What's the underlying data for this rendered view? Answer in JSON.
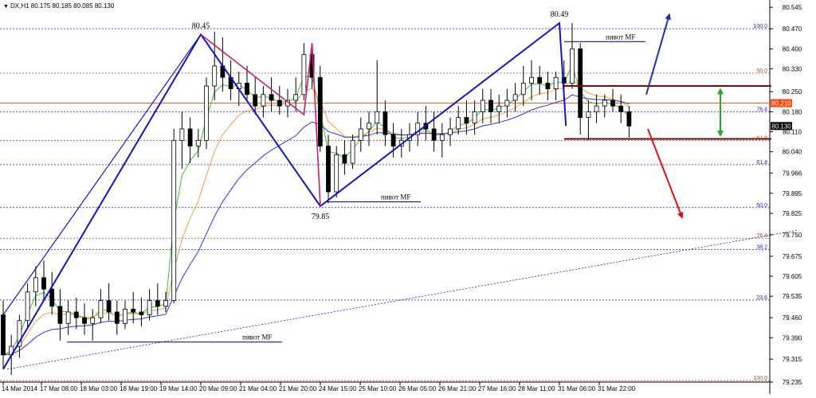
{
  "window": {
    "symbol_line": "DX,H1  80.175 80.185 80.085 80.130",
    "menu_glyph": "▼"
  },
  "colors": {
    "background": "#ffffff",
    "grid_blue": "#1f1fa8",
    "grid_brown": "#a0522d",
    "candle": "#000000",
    "ma_fast": "#2ec72e",
    "ma_mid": "#f0a040",
    "ma_slow": "#3333dd",
    "pattern_blue": "#1515c0",
    "pattern_magenta": "#c0207a",
    "pivot_line": "#3a0a7a",
    "zone_line": "#7a0a0a",
    "arrow_blue": "#2233aa",
    "arrow_red": "#dd1111",
    "arrow_green": "#22aa22",
    "current_price": "#ff4400",
    "price_box": "#000000"
  },
  "chart_data": {
    "type": "candlestick",
    "title": "DX,H1",
    "timeframe": "H1",
    "ohlc_header": {
      "open": 80.175,
      "high": 80.185,
      "low": 80.085,
      "close": 80.13
    },
    "ylim": [
      79.235,
      80.565
    ],
    "y_ticks": [
      80.545,
      80.47,
      80.4,
      80.33,
      80.25,
      80.18,
      80.11,
      80.04,
      79.966,
      79.895,
      79.825,
      79.75,
      79.675,
      79.605,
      79.535,
      79.46,
      79.39,
      79.315,
      79.235
    ],
    "x_ticks": [
      "14 Mar 2014",
      "17 Mar 08:00",
      "18 Mar 03:00",
      "18 Mar 19:00",
      "19 Mar 14:00",
      "20 Mar 09:00",
      "21 Mar 04:00",
      "21 Mar 20:00",
      "24 Mar 15:00",
      "25 Mar 10:00",
      "26 Mar 05:00",
      "26 Mar 21:00",
      "27 Mar 16:00",
      "28 Mar 11:00",
      "31 Mar 06:00",
      "31 Mar 22:00"
    ],
    "current_price": {
      "label": "80.130",
      "value": 80.13
    },
    "price_marker": {
      "label": "80.210",
      "value": 80.21
    },
    "peaks": [
      {
        "label": "80.45",
        "x": "20 Mar 09:00",
        "value": 80.45
      },
      {
        "label": "79.85",
        "x": "24 Mar 15:00",
        "value": 79.85
      },
      {
        "label": "80.49",
        "x": "31 Mar 06:00",
        "value": 80.49
      }
    ],
    "fib_levels": [
      {
        "label": "100.0",
        "value": 80.47,
        "color": "blue"
      },
      {
        "label": "50.0",
        "value": 80.315,
        "color": "brown"
      },
      {
        "label": "76.4",
        "value": 80.18,
        "color": "blue"
      },
      {
        "label": "61.8",
        "value": 80.08,
        "color": "brown"
      },
      {
        "label": "61.8",
        "value": 79.995,
        "color": "blue"
      },
      {
        "label": "50.0",
        "value": 79.845,
        "color": "blue"
      },
      {
        "label": "76.4",
        "value": 79.738,
        "color": "brown"
      },
      {
        "label": "38.2",
        "value": 79.698,
        "color": "blue"
      },
      {
        "label": "23.6",
        "value": 79.522,
        "color": "blue"
      },
      {
        "label": "100.0",
        "value": 79.24,
        "color": "brown"
      }
    ],
    "pivots": [
      {
        "label": "пивот MF",
        "value": 79.375,
        "from": "17 Mar 08:00"
      },
      {
        "label": "пивот MF",
        "value": 79.865,
        "from": "24 Mar 15:00"
      },
      {
        "label": "пивот MF",
        "value": 80.425,
        "from": "31 Mar 06:00"
      }
    ],
    "zone": {
      "upper": 80.27,
      "lower": 80.085
    },
    "candles": [
      [
        0,
        79.47,
        79.52,
        79.28,
        79.33
      ],
      [
        1,
        79.33,
        79.4,
        79.26,
        79.36
      ],
      [
        2,
        79.36,
        79.47,
        79.32,
        79.45
      ],
      [
        3,
        79.45,
        79.58,
        79.42,
        79.55
      ],
      [
        4,
        79.55,
        79.64,
        79.5,
        79.6
      ],
      [
        5,
        79.6,
        79.66,
        79.52,
        79.56
      ],
      [
        6,
        79.56,
        79.62,
        79.47,
        79.5
      ],
      [
        7,
        79.5,
        79.56,
        79.38,
        79.44
      ],
      [
        8,
        79.44,
        79.52,
        79.4,
        79.48
      ],
      [
        9,
        79.48,
        79.53,
        79.42,
        79.46
      ],
      [
        10,
        79.46,
        79.51,
        79.4,
        79.44
      ],
      [
        11,
        79.44,
        79.49,
        79.38,
        79.46
      ],
      [
        12,
        79.46,
        79.56,
        79.44,
        79.52
      ],
      [
        13,
        79.52,
        79.58,
        79.45,
        79.48
      ],
      [
        14,
        79.48,
        79.52,
        79.4,
        79.44
      ],
      [
        15,
        79.44,
        79.52,
        79.42,
        79.49
      ],
      [
        16,
        79.49,
        79.55,
        79.44,
        79.48
      ],
      [
        17,
        79.48,
        79.53,
        79.43,
        79.47
      ],
      [
        18,
        79.47,
        79.56,
        79.45,
        79.52
      ],
      [
        19,
        79.52,
        79.58,
        79.47,
        79.5
      ],
      [
        20,
        79.5,
        79.55,
        79.48,
        79.52
      ],
      [
        21,
        79.52,
        80.12,
        79.51,
        80.08
      ],
      [
        22,
        80.08,
        80.18,
        79.98,
        80.12
      ],
      [
        23,
        80.12,
        80.16,
        80.0,
        80.06
      ],
      [
        24,
        80.06,
        80.12,
        80.02,
        80.08
      ],
      [
        25,
        80.08,
        80.3,
        80.05,
        80.27
      ],
      [
        26,
        80.27,
        80.46,
        80.22,
        80.34
      ],
      [
        27,
        80.34,
        80.44,
        80.25,
        80.3
      ],
      [
        28,
        80.3,
        80.36,
        80.22,
        80.26
      ],
      [
        29,
        80.26,
        80.32,
        80.2,
        80.28
      ],
      [
        30,
        80.28,
        80.34,
        80.22,
        80.24
      ],
      [
        31,
        80.24,
        80.3,
        80.17,
        80.2
      ],
      [
        32,
        80.2,
        80.27,
        80.16,
        80.24
      ],
      [
        33,
        80.24,
        80.3,
        80.18,
        80.22
      ],
      [
        34,
        80.22,
        80.27,
        80.17,
        80.2
      ],
      [
        35,
        80.2,
        80.26,
        80.16,
        80.22
      ],
      [
        36,
        80.22,
        80.3,
        80.18,
        80.24
      ],
      [
        37,
        80.24,
        80.42,
        80.22,
        80.38
      ],
      [
        38,
        80.38,
        80.4,
        80.26,
        80.3
      ],
      [
        39,
        80.3,
        80.34,
        80.04,
        80.06
      ],
      [
        40,
        80.06,
        80.1,
        79.86,
        79.9
      ],
      [
        41,
        79.9,
        80.06,
        79.88,
        80.03
      ],
      [
        42,
        80.03,
        80.08,
        79.96,
        80.0
      ],
      [
        43,
        80.0,
        80.1,
        79.98,
        80.08
      ],
      [
        44,
        80.08,
        80.16,
        80.04,
        80.12
      ],
      [
        45,
        80.12,
        80.18,
        80.06,
        80.14
      ],
      [
        46,
        80.14,
        80.36,
        80.1,
        80.18
      ],
      [
        47,
        80.18,
        80.22,
        80.06,
        80.1
      ],
      [
        48,
        80.1,
        80.14,
        80.02,
        80.06
      ],
      [
        49,
        80.06,
        80.12,
        80.02,
        80.08
      ],
      [
        50,
        80.08,
        80.14,
        80.04,
        80.1
      ],
      [
        51,
        80.1,
        80.18,
        80.06,
        80.14
      ],
      [
        52,
        80.14,
        80.2,
        80.08,
        80.12
      ],
      [
        53,
        80.12,
        80.18,
        80.04,
        80.08
      ],
      [
        54,
        80.08,
        80.14,
        80.02,
        80.1
      ],
      [
        55,
        80.1,
        80.16,
        80.06,
        80.12
      ],
      [
        56,
        80.12,
        80.2,
        80.1,
        80.16
      ],
      [
        57,
        80.16,
        80.22,
        80.1,
        80.14
      ],
      [
        58,
        80.14,
        80.22,
        80.1,
        80.18
      ],
      [
        59,
        80.18,
        80.26,
        80.14,
        80.22
      ],
      [
        60,
        80.22,
        80.26,
        80.14,
        80.18
      ],
      [
        61,
        80.18,
        80.24,
        80.14,
        80.2
      ],
      [
        62,
        80.2,
        80.26,
        80.16,
        80.22
      ],
      [
        63,
        80.22,
        80.28,
        80.18,
        80.24
      ],
      [
        64,
        80.24,
        80.34,
        80.2,
        80.28
      ],
      [
        65,
        80.28,
        80.36,
        80.22,
        80.3
      ],
      [
        66,
        80.3,
        80.34,
        80.24,
        80.28
      ],
      [
        67,
        80.28,
        80.32,
        80.22,
        80.26
      ],
      [
        68,
        80.26,
        80.32,
        80.22,
        80.3
      ],
      [
        69,
        80.3,
        80.36,
        80.24,
        80.28
      ],
      [
        70,
        80.28,
        80.49,
        80.26,
        80.4
      ],
      [
        71,
        80.4,
        80.42,
        80.1,
        80.16
      ],
      [
        72,
        80.16,
        80.22,
        80.08,
        80.18
      ],
      [
        73,
        80.18,
        80.24,
        80.14,
        80.2
      ],
      [
        74,
        80.2,
        80.24,
        80.16,
        80.22
      ],
      [
        75,
        80.22,
        80.26,
        80.18,
        80.2
      ],
      [
        76,
        80.2,
        80.24,
        80.14,
        80.18
      ],
      [
        77,
        80.18,
        80.2,
        80.09,
        80.13
      ]
    ]
  }
}
